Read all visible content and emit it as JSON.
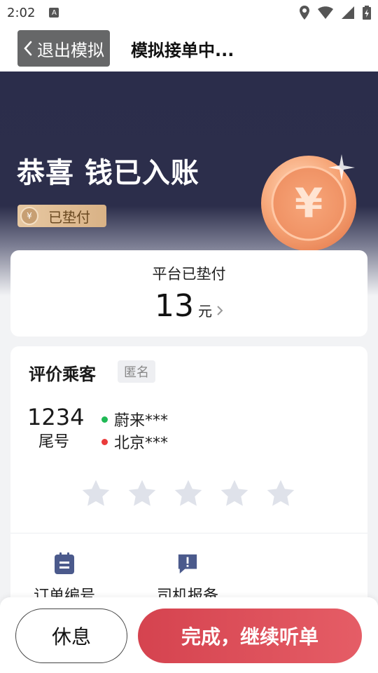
{
  "status_bar": {
    "time": "2:02",
    "icons": [
      "a-notification-icon",
      "location-icon",
      "wifi-icon",
      "signal-icon",
      "battery-icon"
    ]
  },
  "header": {
    "back_label": "退出模拟",
    "title": "模拟接单中..."
  },
  "hero": {
    "title": "恭喜 钱已入账",
    "tag": "已垫付",
    "coin_symbol": "¥"
  },
  "payment": {
    "label": "平台已垫付",
    "amount": "13",
    "unit": "元"
  },
  "rating": {
    "title": "评价乘客",
    "anon_badge": "匿名",
    "tail_number": "1234",
    "tail_label": "尾号",
    "route": [
      {
        "text": "蔚来***",
        "dot_color": "#1fb955"
      },
      {
        "text": "北京***",
        "dot_color": "#ea3b3b"
      }
    ],
    "stars_filled": 0,
    "stars_total": 5,
    "tools": [
      {
        "label": "订单编号",
        "icon": "order-clipboard-icon"
      },
      {
        "label": "司机报备",
        "icon": "driver-report-icon"
      }
    ]
  },
  "actions": {
    "rest_label": "休息",
    "continue_label": "完成，继续听单"
  },
  "colors": {
    "accent": "#d5434f",
    "hero_bg": "#2b2d4b",
    "tool_icon": "#4b5a8c",
    "star_empty": "#dfe2ea"
  }
}
